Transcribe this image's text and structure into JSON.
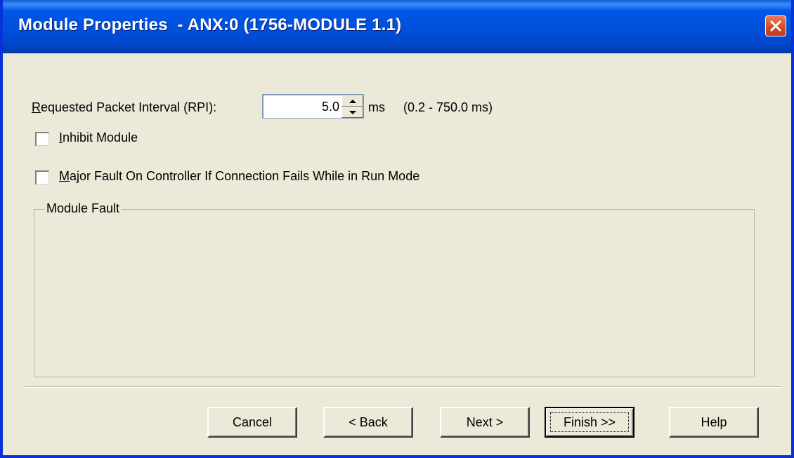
{
  "window": {
    "title": "Module Properties  - ANX:0 (1756-MODULE 1.1)"
  },
  "rpi": {
    "label": "Requested Packet Interval (RPI):",
    "value": "5.0",
    "unit": "ms",
    "range": "(0.2 - 750.0 ms)"
  },
  "options": {
    "inhibit_label": "Inhibit Module",
    "inhibit_checked": false,
    "major_fault_label": "Major Fault On Controller If Connection Fails While in Run Mode",
    "major_fault_checked": false
  },
  "module_fault": {
    "group_label": "Module Fault"
  },
  "buttons": {
    "cancel": "Cancel",
    "back": "< Back",
    "next": "Next >",
    "finish": "Finish >>",
    "help": "Help"
  },
  "icons": [
    "close-icon",
    "spin-up-icon",
    "spin-down-icon"
  ],
  "colors": {
    "titlebar": "#0050dc",
    "dialog_bg": "#ece9d8",
    "close_button": "#d24a1e"
  }
}
